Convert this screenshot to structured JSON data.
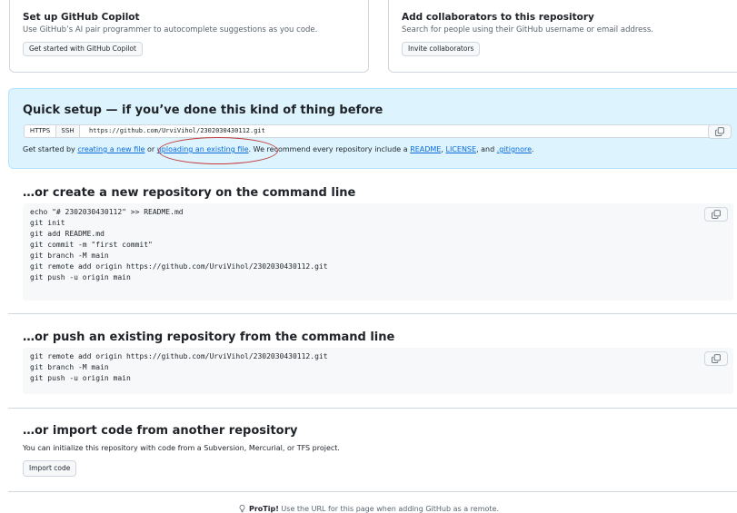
{
  "copilot_card": {
    "title": "Set up GitHub Copilot",
    "description": "Use GitHub’s AI pair programmer to autocomplete suggestions as you code.",
    "button": "Get started with GitHub Copilot"
  },
  "collab_card": {
    "title": "Add collaborators to this repository",
    "description": "Search for people using their GitHub username or email address.",
    "button": "Invite collaborators"
  },
  "quick_setup": {
    "title": "Quick setup — if you’ve done this kind of thing before",
    "protocols": [
      "HTTPS",
      "SSH"
    ],
    "selected_protocol": "SSH",
    "url": "https://github.com/UrviVihol/2302030430112.git",
    "help": {
      "prefix": "Get started by ",
      "link_new_file": "creating a new file",
      "or": " or ",
      "link_upload": "uploading an existing file",
      "mid": ". We recommend every repository include a ",
      "link_readme": "README",
      "comma": ", ",
      "link_license": "LICENSE",
      "and": ", and ",
      "link_gitignore": ".gitignore",
      "suffix": "."
    }
  },
  "new_repo": {
    "title": "…or create a new repository on the command line",
    "lines": [
      "echo \"# 2302030430112\" >> README.md",
      "git init",
      "git add README.md",
      "git commit -m \"first commit\"",
      "git branch -M main",
      "git remote add origin https://github.com/UrviVihol/2302030430112.git",
      "git push -u origin main"
    ]
  },
  "push_existing": {
    "title": "…or push an existing repository from the command line",
    "lines": [
      "git remote add origin https://github.com/UrviVihol/2302030430112.git",
      "git branch -M main",
      "git push -u origin main"
    ]
  },
  "import": {
    "title": "…or import code from another repository",
    "description": "You can initialize this repository with code from a Subversion, Mercurial, or TFS project.",
    "button": "Import code"
  },
  "protip": {
    "label": "ProTip!",
    "text": " Use the URL for this page when adding GitHub as a remote."
  },
  "colors": {
    "link": "#0969da",
    "quick_bg": "#ddf4ff",
    "annotation": "#c23a3a"
  }
}
